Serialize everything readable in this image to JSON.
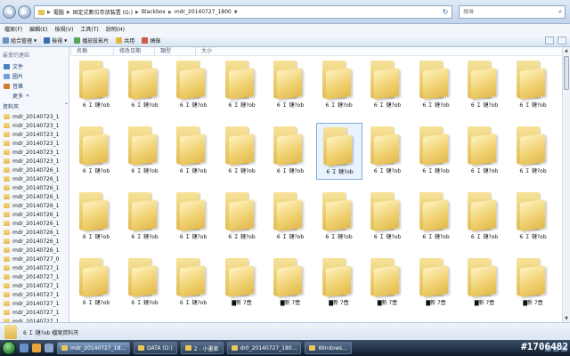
{
  "address": {
    "segments": [
      "電腦",
      "固定式數位存放裝置 (G:)",
      "Blackbox",
      "mdr_20140727_1800"
    ],
    "search_placeholder": "搜尋"
  },
  "menu": [
    "檔案(F)",
    "編輯(E)",
    "檢視(V)",
    "工具(T)",
    "說明(H)"
  ],
  "toolbar": {
    "organize": "組合管理",
    "views": "檢視",
    "slideshow": "播放投影片",
    "share": "共用",
    "burn": "燒錄"
  },
  "nav": {
    "favorites_header": "最愛的連結",
    "favorites": [
      "文件",
      "圖片",
      "音樂"
    ],
    "more": "更多",
    "folders_header": "資料夾",
    "tree": [
      "mdr_20140723_1",
      "mdr_20140723_1",
      "mdr_20140723_1",
      "mdr_20140723_1",
      "mdr_20140723_1",
      "mdr_20140723_1",
      "mdr_20140726_1",
      "mdr_20140726_1",
      "mdr_20140726_1",
      "mdr_20140726_1",
      "mdr_20140726_1",
      "mdr_20140726_1",
      "mdr_20140726_1",
      "mdr_20140726_1",
      "mdr_20140726_1",
      "mdr_20140726_1",
      "mdr_20140727_0",
      "mdr_20140727_1",
      "mdr_20140727_1",
      "mdr_20140727_1",
      "mdr_20140727_1",
      "mdr_20140727_1",
      "mdr_20140727_1",
      "mdr_20140727_1",
      "mdr_20140727_1",
      "mdr_20140727_1",
      "mdr_20140727_1",
      "mdr_20140727_1",
      "mdr_20140727_1"
    ]
  },
  "columns": [
    "名稱",
    "修改日期",
    "類型",
    "大小"
  ],
  "files": {
    "label_a": "6 Ｉ 鏈?ob",
    "label_b": "▇新 7壺",
    "rows": [
      [
        "6 Ｉ 鏈?ob",
        "6 Ｉ 鏈?ob",
        "6 Ｉ 鏈?ob",
        "6 Ｉ 鏈?ob",
        "6 Ｉ 鏈?ob",
        "6 Ｉ 鏈?ob",
        "6 Ｉ 鏈?ob",
        "6 Ｉ 鏈?ob",
        "6 Ｉ 鏈?ob",
        "6 Ｉ 鏈?ob"
      ],
      [
        "6 Ｉ 鏈?ob",
        "6 Ｉ 鏈?ob",
        "6 Ｉ 鏈?ob",
        "6 Ｉ 鏈?ob",
        "6 Ｉ 鏈?ob",
        "6 Ｉ 鏈?ob",
        "6 Ｉ 鏈?ob",
        "6 Ｉ 鏈?ob",
        "6 Ｉ 鏈?ob",
        "6 Ｉ 鏈?ob"
      ],
      [
        "6 Ｉ 鏈?ob",
        "6 Ｉ 鏈?ob",
        "6 Ｉ 鏈?ob",
        "6 Ｉ 鏈?ob",
        "6 Ｉ 鏈?ob",
        "6 Ｉ 鏈?ob",
        "6 Ｉ 鏈?ob",
        "6 Ｉ 鏈?ob",
        "6 Ｉ 鏈?ob",
        "6 Ｉ 鏈?ob"
      ],
      [
        "6 Ｉ 鏈?ob",
        "6 Ｉ 鏈?ob",
        "6 Ｉ 鏈?ob",
        "▇新 7壺",
        "▇新 7壺",
        "▇新 7壺",
        "▇新 7壺",
        "▇新 7壺",
        "▇新 7壺",
        "▇新 7壺"
      ]
    ],
    "selected": [
      1,
      5
    ]
  },
  "details": {
    "text": "6 Ｉ 鏈?ob 檔案資料夾"
  },
  "taskbar": {
    "tasks": [
      "mdr_20140727_18...",
      "DATA (D:)",
      "2 - 小畫家",
      "dr0_20140727_180...",
      "Windows..."
    ],
    "active_index": 0
  },
  "watermark": "#1706482"
}
